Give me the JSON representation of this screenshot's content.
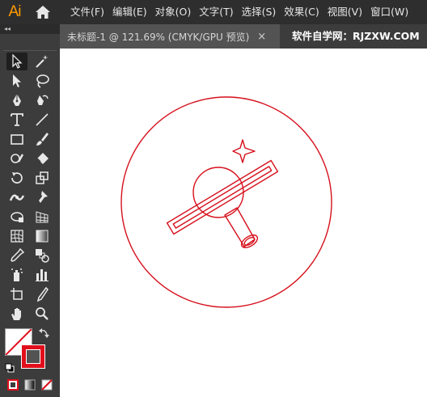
{
  "app": {
    "logo": "Ai"
  },
  "menu": [
    "文件(F)",
    "编辑(E)",
    "对象(O)",
    "文字(T)",
    "选择(S)",
    "效果(C)",
    "视图(V)",
    "窗口(W)"
  ],
  "document_tab": {
    "title": "未标题-1 @ 121.69% (CMYK/GPU 预览)",
    "close": "×"
  },
  "watermark": "软件自学网：RJZXW.COM",
  "panel_collapse": "◂◂",
  "tools": [
    "selection-tool",
    "magic-wand-tool",
    "direct-selection-tool",
    "lasso-tool",
    "pen-tool",
    "curvature-tool",
    "type-tool",
    "line-segment-tool",
    "rectangle-tool",
    "paintbrush-tool",
    "shaper-tool",
    "eraser-tool",
    "rotate-tool",
    "scale-tool",
    "width-tool",
    "puppet-warp-tool",
    "free-transform-tool",
    "perspective-grid-tool",
    "mesh-tool",
    "gradient-tool",
    "eyedropper-tool",
    "blend-tool",
    "symbol-sprayer-tool",
    "column-graph-tool",
    "artboard-tool",
    "slice-tool",
    "hand-tool",
    "zoom-tool"
  ],
  "colors": {
    "stroke": "#e10e1c",
    "fill": "none",
    "artwork": "#d6101c",
    "accent_logo": "#ff9a00"
  }
}
